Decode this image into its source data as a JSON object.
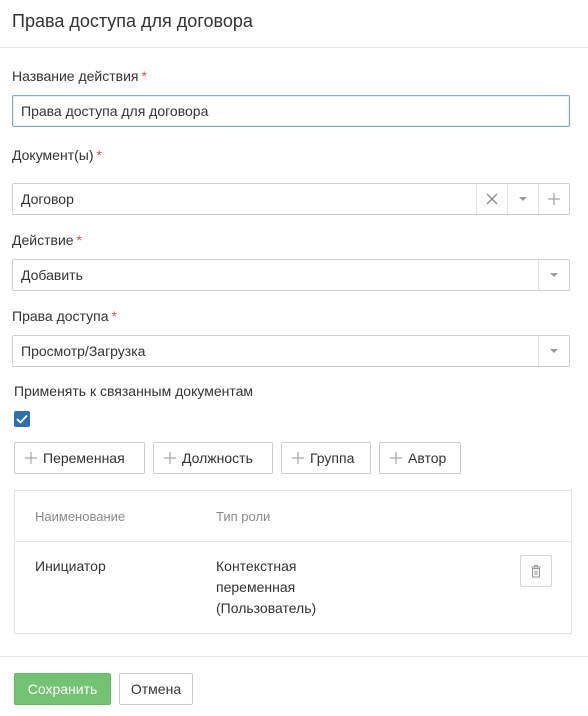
{
  "dialog": {
    "title": "Права доступа для договора"
  },
  "form": {
    "action_name": {
      "label": "Название действия",
      "required_mark": "*",
      "value": "Права доступа для договора"
    },
    "documents": {
      "label": "Документ(ы)",
      "required_mark": "*",
      "value": "Договор"
    },
    "action": {
      "label": "Действие",
      "required_mark": "*",
      "value": "Добавить"
    },
    "access_rights": {
      "label": "Права доступа",
      "required_mark": "*",
      "value": "Просмотр/Загрузка"
    },
    "apply_related": {
      "label": "Применять к связанным документам",
      "checked": true
    }
  },
  "add_buttons": [
    {
      "label": "Переменная"
    },
    {
      "label": "Должность"
    },
    {
      "label": "Группа"
    },
    {
      "label": "Автор"
    }
  ],
  "table": {
    "columns": [
      "Наименование",
      "Тип роли"
    ],
    "rows": [
      {
        "name": "Инициатор",
        "role_type_lines": [
          "Контекстная",
          "переменная",
          "(Пользователь)"
        ]
      }
    ]
  },
  "footer": {
    "save_label": "Сохранить",
    "cancel_label": "Отмена"
  },
  "colors": {
    "accent": "#2f6fb0",
    "success": "#5cb85c",
    "required": "#d9534f"
  },
  "icons": {
    "clear": "close-icon",
    "dropdown": "chevron-down-icon",
    "add": "plus-icon",
    "delete": "trash-icon",
    "check": "check-icon"
  }
}
